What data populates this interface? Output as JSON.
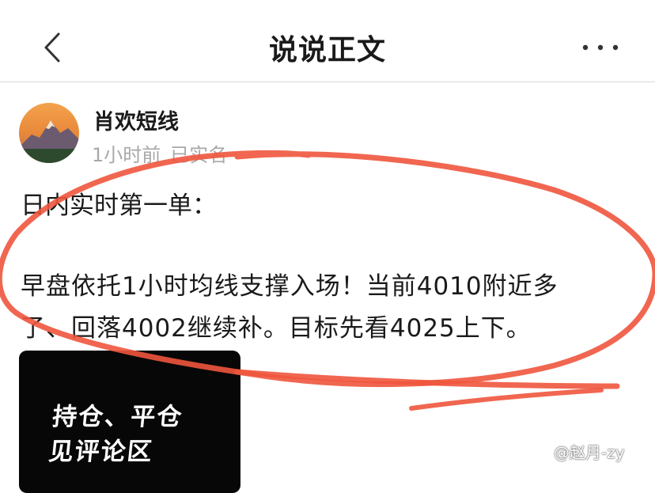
{
  "nav": {
    "title": "说说正文",
    "back_icon": "chevron-left-icon",
    "more_icon": "more-dots-icon"
  },
  "author": {
    "name": "肖欢短线",
    "time": "1小时前",
    "verification": "已实名"
  },
  "post": {
    "line1": "日内实时第一单：",
    "line2": "早盘依托1小时均线支撑入场！当前4010附近多",
    "line3": "了、回落4002继续补。目标先看4025上下。"
  },
  "media": {
    "line1": "持仓、平仓",
    "line2": "见评论区"
  },
  "watermark": "@赵月-zy",
  "colors": {
    "annotation": "#f0553d",
    "meta_text": "#a8a8a8",
    "divider": "#d9d9d9"
  }
}
